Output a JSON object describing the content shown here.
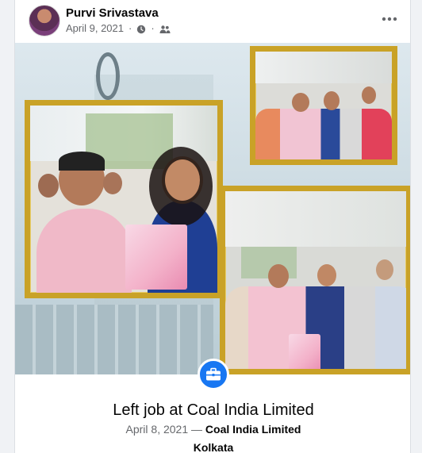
{
  "post": {
    "author": "Purvi Srivastava",
    "date": "April 9, 2021",
    "privacy_icon": "friends-icon",
    "clock_icon": "clock-icon",
    "more_icon": "more-options-icon"
  },
  "event": {
    "icon": "briefcase-icon",
    "title": "Left job at Coal India Limited",
    "date": "April 8, 2021",
    "separator": "—",
    "company": "Coal India Limited",
    "location": "Kolkata"
  },
  "colors": {
    "accent": "#1877f2",
    "frame_gold": "#c9a227",
    "text_primary": "#050505",
    "text_secondary": "#65676b",
    "background": "#f0f2f5"
  }
}
